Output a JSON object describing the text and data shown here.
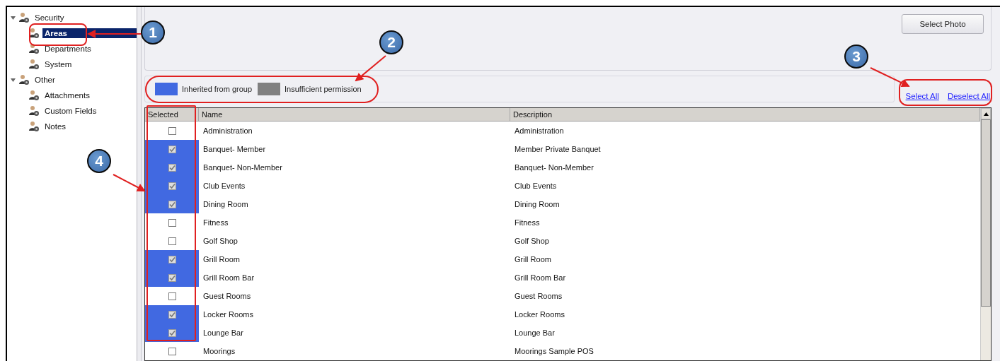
{
  "tree": [
    {
      "label": "Security",
      "expanded": true,
      "selected": false,
      "children": [
        {
          "label": "Areas",
          "selected": true
        },
        {
          "label": "Departments",
          "selected": false
        },
        {
          "label": "System",
          "selected": false
        }
      ]
    },
    {
      "label": "Other",
      "expanded": true,
      "selected": false,
      "children": [
        {
          "label": "Attachments",
          "selected": false
        },
        {
          "label": "Custom Fields",
          "selected": false
        },
        {
          "label": "Notes",
          "selected": false
        }
      ]
    }
  ],
  "photo_button": "Select Photo",
  "legend": [
    {
      "label": "Inherited from group",
      "color": "#4169e1"
    },
    {
      "label": "Insufficient permission",
      "color": "#808080"
    }
  ],
  "links": [
    "Select All",
    "Deselect All"
  ],
  "table": {
    "columns": [
      "Selected",
      "Name",
      "Description"
    ],
    "rows": [
      {
        "checked": false,
        "inherited": false,
        "name": "Administration",
        "description": "Administration"
      },
      {
        "checked": true,
        "inherited": true,
        "name": "Banquet- Member",
        "description": "Member Private Banquet"
      },
      {
        "checked": true,
        "inherited": true,
        "name": "Banquet- Non-Member",
        "description": "Banquet- Non-Member"
      },
      {
        "checked": true,
        "inherited": true,
        "name": "Club Events",
        "description": "Club Events"
      },
      {
        "checked": true,
        "inherited": true,
        "name": "Dining Room",
        "description": "Dining Room"
      },
      {
        "checked": false,
        "inherited": false,
        "name": "Fitness",
        "description": "Fitness"
      },
      {
        "checked": false,
        "inherited": false,
        "name": "Golf Shop",
        "description": "Golf Shop"
      },
      {
        "checked": true,
        "inherited": true,
        "name": "Grill Room",
        "description": "Grill Room"
      },
      {
        "checked": true,
        "inherited": true,
        "name": "Grill Room Bar",
        "description": "Grill Room Bar"
      },
      {
        "checked": false,
        "inherited": false,
        "name": "Guest Rooms",
        "description": "Guest Rooms"
      },
      {
        "checked": true,
        "inherited": true,
        "name": "Locker Rooms",
        "description": "Locker Rooms"
      },
      {
        "checked": true,
        "inherited": true,
        "name": "Lounge Bar",
        "description": "Lounge Bar"
      },
      {
        "checked": false,
        "inherited": false,
        "name": "Moorings",
        "description": "Moorings Sample POS"
      }
    ]
  },
  "callouts": [
    {
      "number": "1"
    },
    {
      "number": "2"
    },
    {
      "number": "3"
    },
    {
      "number": "4"
    }
  ]
}
